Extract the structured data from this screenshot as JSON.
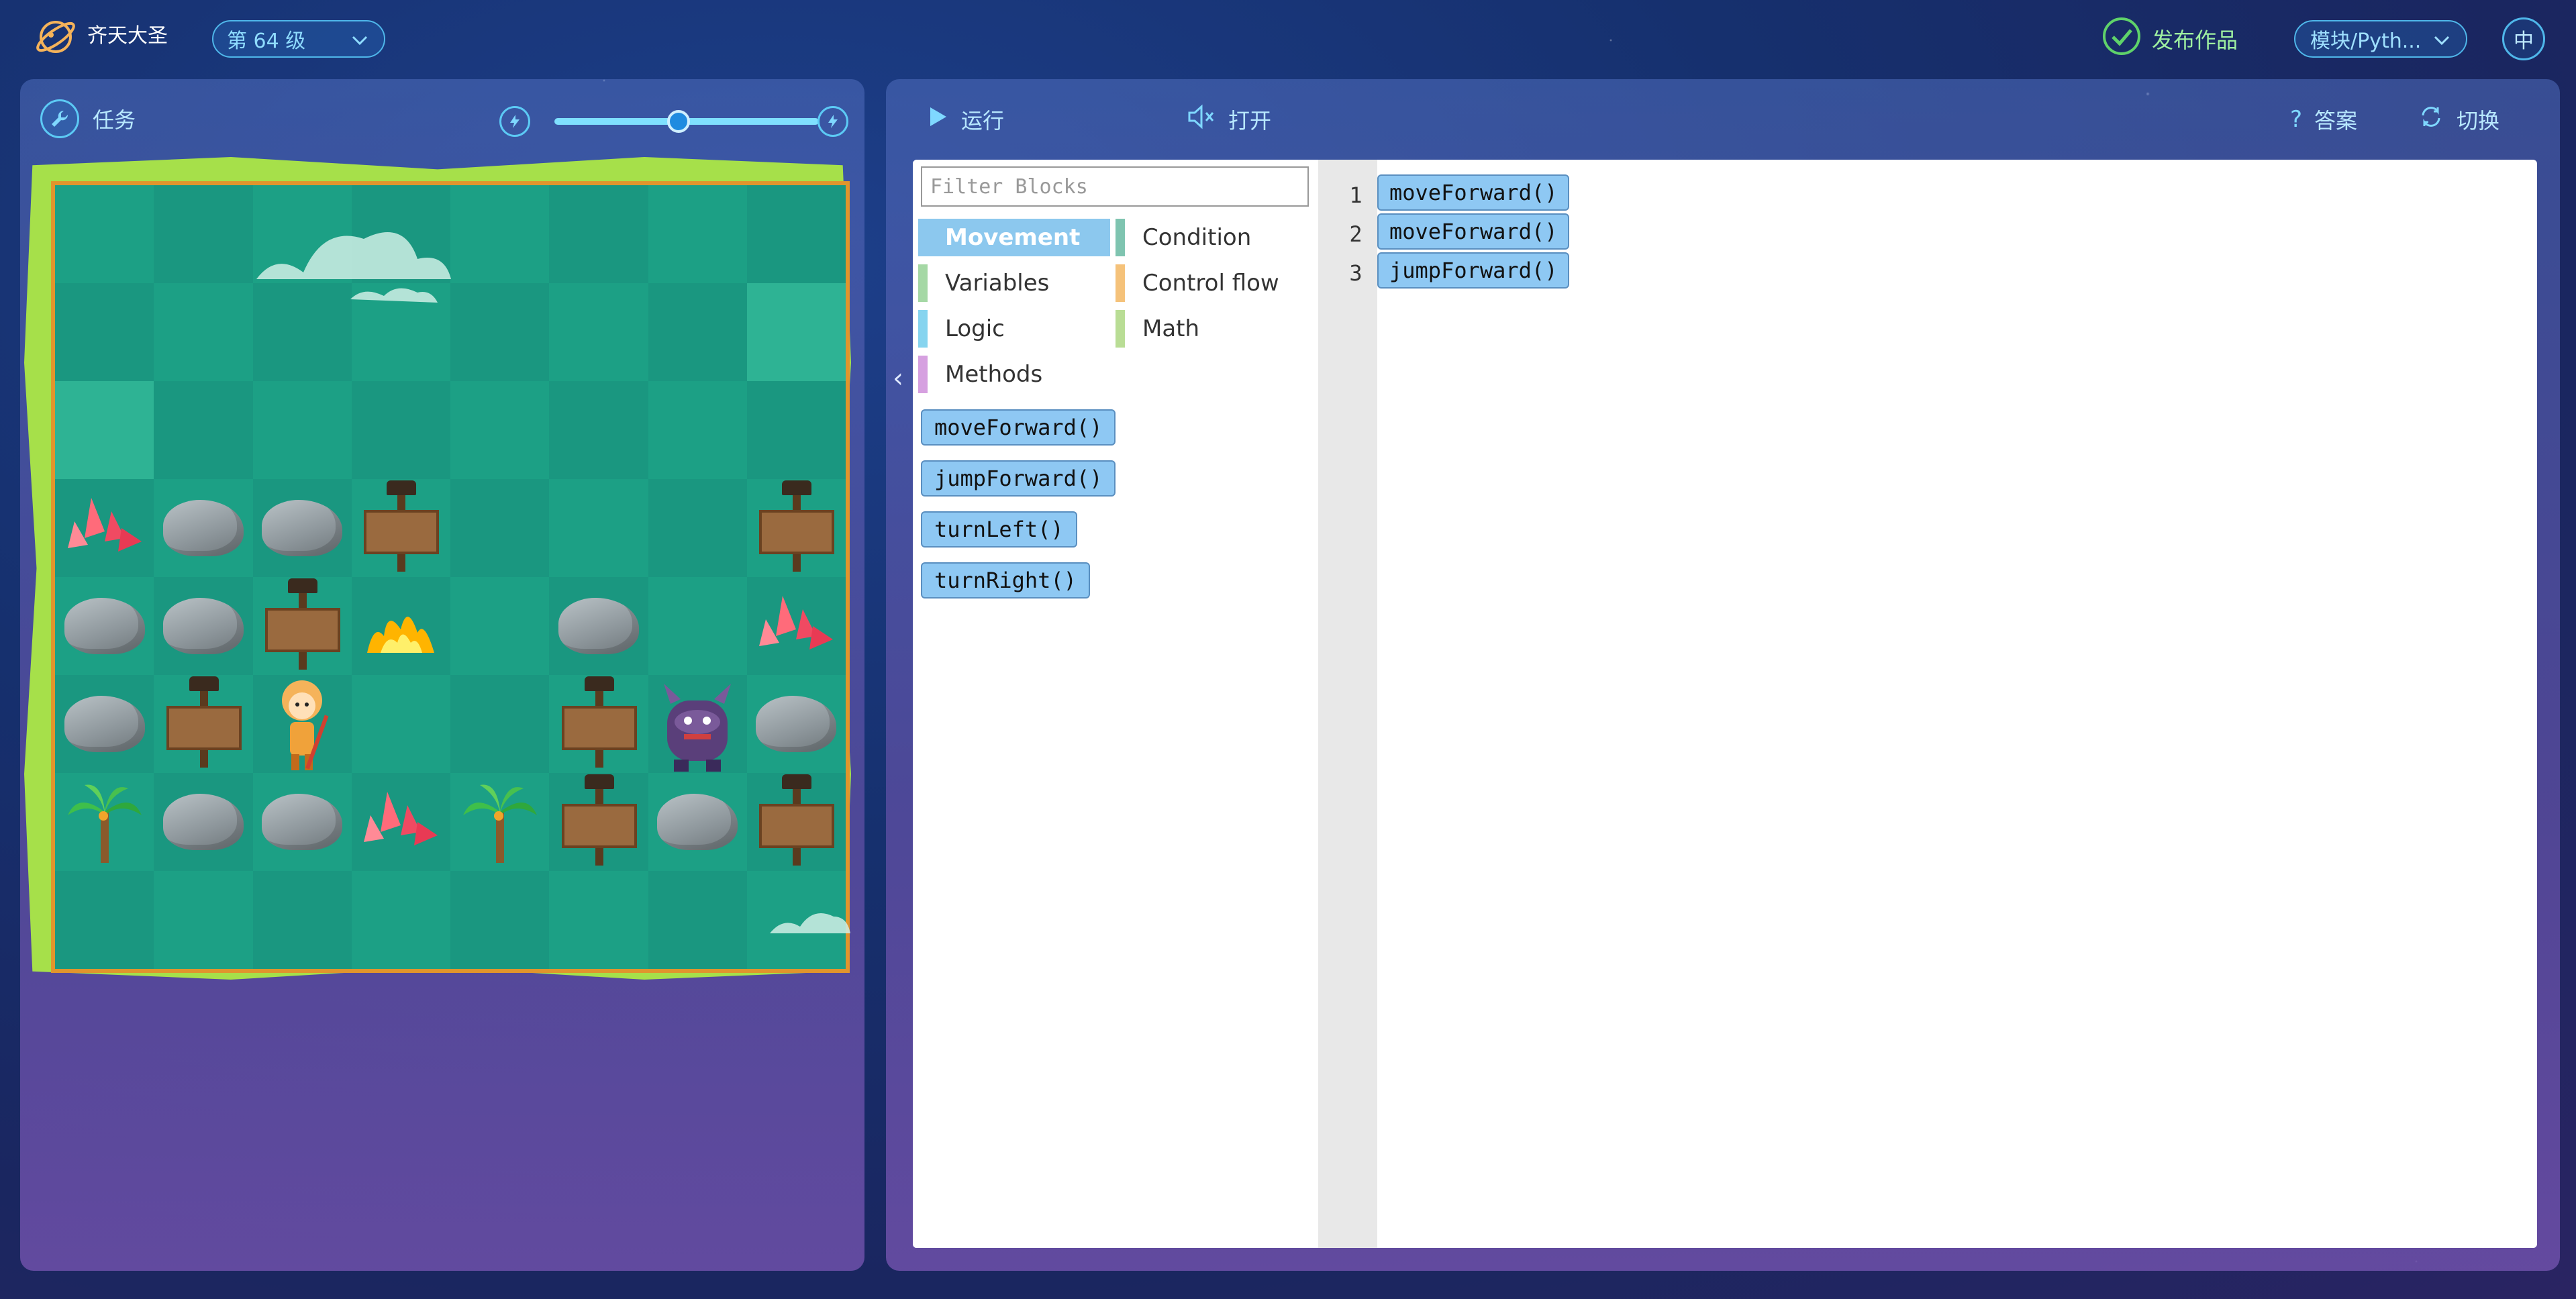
{
  "app": {
    "title": "齐天大圣",
    "level": "第 64 级",
    "publish": "发布作品",
    "mode": "模块/Pyth...",
    "language": "中"
  },
  "left": {
    "task_label": "任务",
    "speed_value": 0.47
  },
  "toolbar": {
    "run": "运行",
    "open": "打开",
    "answer": "答案",
    "switch": "切换"
  },
  "editor": {
    "filter_placeholder": "Filter Blocks",
    "categories": [
      {
        "label": "Movement",
        "color": "#8cc8ee"
      },
      {
        "label": "Condition",
        "color": "#7fc4b0"
      },
      {
        "label": "Variables",
        "color": "#a5d8a5"
      },
      {
        "label": "Control flow",
        "color": "#f5c27a"
      },
      {
        "label": "Logic",
        "color": "#86d4ef"
      },
      {
        "label": "Math",
        "color": "#b9dd95"
      },
      {
        "label": "Methods",
        "color": "#d6a0e0"
      }
    ],
    "palette": [
      "moveForward()",
      "jumpForward()",
      "turnLeft()",
      "turnRight()"
    ],
    "code": [
      {
        "line": "1",
        "text": "moveForward()"
      },
      {
        "line": "2",
        "text": "moveForward()"
      },
      {
        "line": "3",
        "text": "jumpForward()"
      }
    ]
  },
  "colors": {
    "accent": "#4fb7ea",
    "publish": "#5fd26a",
    "block": "#8ec8f3"
  }
}
